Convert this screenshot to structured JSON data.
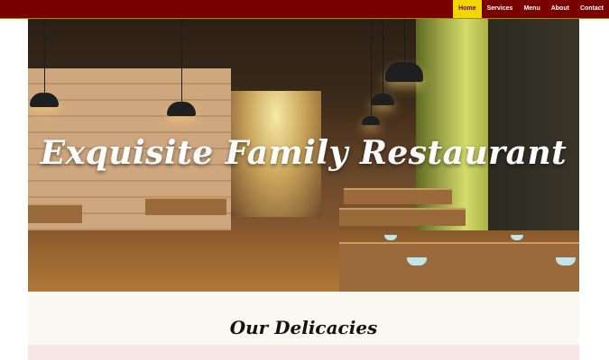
{
  "nav": {
    "items": [
      {
        "label": "Home",
        "active": true
      },
      {
        "label": "Services",
        "active": false
      },
      {
        "label": "Menu",
        "active": false
      },
      {
        "label": "About",
        "active": false
      },
      {
        "label": "Contact",
        "active": false
      }
    ]
  },
  "hero": {
    "title": "Exquisite Family Restaurant"
  },
  "section": {
    "title": "Our Delicacies"
  },
  "colors": {
    "topbar": "#7a0000",
    "active_nav": "#f2d600",
    "section_bg": "#fbf7f1",
    "strip": "#f8e6e6"
  }
}
